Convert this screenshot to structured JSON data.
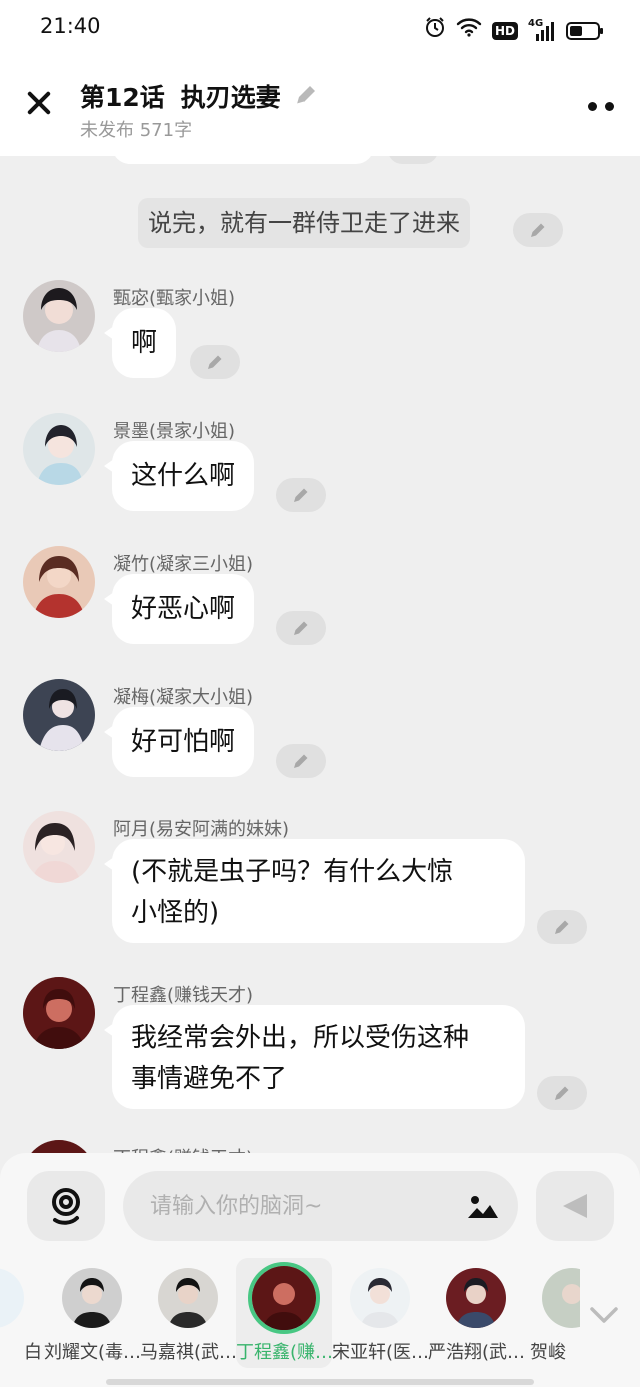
{
  "status": {
    "time": "21:40",
    "network": "4G",
    "hd": "HD"
  },
  "header": {
    "chapter": "第12话",
    "title": "执刃选妻",
    "subtitle": "未发布 571字"
  },
  "chat": {
    "narration": "说完，就有一群侍卫走了进来",
    "messages": [
      {
        "name": "甄宓(甄家小姐)",
        "text": "啊"
      },
      {
        "name": "景墨(景家小姐)",
        "text": "这什么啊"
      },
      {
        "name": "凝竹(凝家三小姐)",
        "text": "好恶心啊"
      },
      {
        "name": "凝梅(凝家大小姐)",
        "text": "好可怕啊"
      },
      {
        "name": "阿月(易安阿满的妹妹)",
        "text_line1": "(不就是虫子吗？有什么大惊",
        "text_line2": "小怪的)"
      },
      {
        "name": "丁程鑫(赚钱天才)",
        "text_line1": "我经常会外出，所以受伤这种",
        "text_line2": "事情避免不了"
      },
      {
        "name": "丁程鑫(赚钱天才)"
      }
    ]
  },
  "input": {
    "placeholder": "请输入你的脑洞~"
  },
  "characters": [
    {
      "label": "白"
    },
    {
      "label": "刘耀文(毒…"
    },
    {
      "label": "马嘉祺(武…"
    },
    {
      "label": "丁程鑫(赚…"
    },
    {
      "label": "宋亚轩(医…"
    },
    {
      "label": "严浩翔(武…"
    },
    {
      "label": "贺峻"
    }
  ],
  "colors": {
    "accent": "#48c783",
    "bubble": "#ffffff",
    "background": "#efefef"
  },
  "icons": [
    "close-icon",
    "pencil-icon",
    "more-icon",
    "voice-icon",
    "image-icon",
    "send-icon",
    "chevron-down-icon"
  ]
}
